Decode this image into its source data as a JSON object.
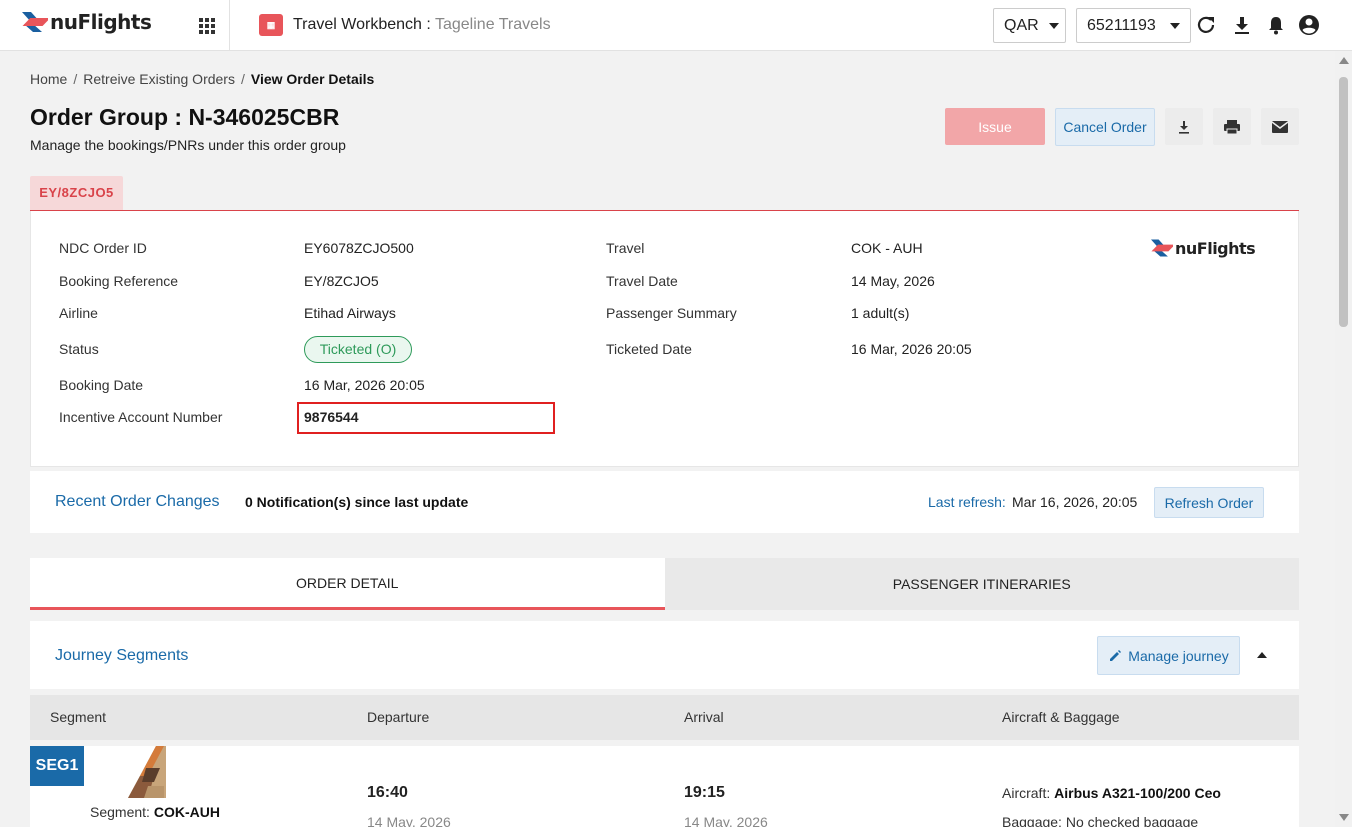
{
  "header": {
    "logo_text": "nuFlights",
    "workbench_title": "Travel Workbench :",
    "workbench_agency": "Tageline Travels",
    "currency": "QAR",
    "account": "65211193"
  },
  "breadcrumb": {
    "home": "Home",
    "existing": "Retreive Existing Orders",
    "current": "View Order Details"
  },
  "order": {
    "title": "Order Group : N-346025CBR",
    "subtitle": "Manage the bookings/PNRs under this order group",
    "issue_label": "Issue",
    "cancel_label": "Cancel Order",
    "pnr_tab": "EY/8ZCJO5"
  },
  "details": {
    "ndc_label": "NDC Order ID",
    "ndc_value": "EY6078ZCJO500",
    "booking_ref_label": "Booking Reference",
    "booking_ref_value": "EY/8ZCJO5",
    "airline_label": "Airline",
    "airline_value": "Etihad Airways",
    "status_label": "Status",
    "status_value": "Ticketed (O)",
    "booking_date_label": "Booking Date",
    "booking_date_value": "16 Mar, 2026 20:05",
    "incentive_label": "Incentive Account Number",
    "incentive_value": "9876544",
    "travel_label": "Travel",
    "travel_value": "COK - AUH",
    "travel_date_label": "Travel Date",
    "travel_date_value": "14 May, 2026",
    "pax_label": "Passenger Summary",
    "pax_value": "1 adult(s)",
    "ticketed_label": "Ticketed Date",
    "ticketed_value": "16 Mar, 2026 20:05",
    "logo_text": "nuFlights"
  },
  "recent": {
    "title": "Recent Order Changes",
    "notifications": "0 Notification(s) since last update",
    "last_refresh_label": "Last refresh:",
    "last_refresh_value": "Mar 16, 2026, 20:05",
    "refresh_label": "Refresh Order"
  },
  "tabs": {
    "order_detail": "ORDER DETAIL",
    "itineraries": "PASSENGER ITINERARIES"
  },
  "journey": {
    "title": "Journey Segments",
    "manage_label": "Manage journey",
    "columns": [
      "Segment",
      "Departure",
      "Arrival",
      "Aircraft & Baggage"
    ]
  },
  "segment": {
    "badge": "SEG1",
    "segment_label": "Segment:",
    "segment_value": "COK-AUH",
    "dep_time": "16:40",
    "dep_date": "14 May, 2026",
    "arr_time": "19:15",
    "arr_date": "14 May, 2026",
    "aircraft_label": "Aircraft:",
    "aircraft_value": "Airbus A321-100/200 Ceo",
    "baggage_label": "Baggage:",
    "baggage_value": "No checked baggage"
  },
  "colors": {
    "brand_red": "#e8555a",
    "link_blue": "#1a6aa8",
    "status_green": "#2e9a5a",
    "highlight_red": "#e02020"
  }
}
